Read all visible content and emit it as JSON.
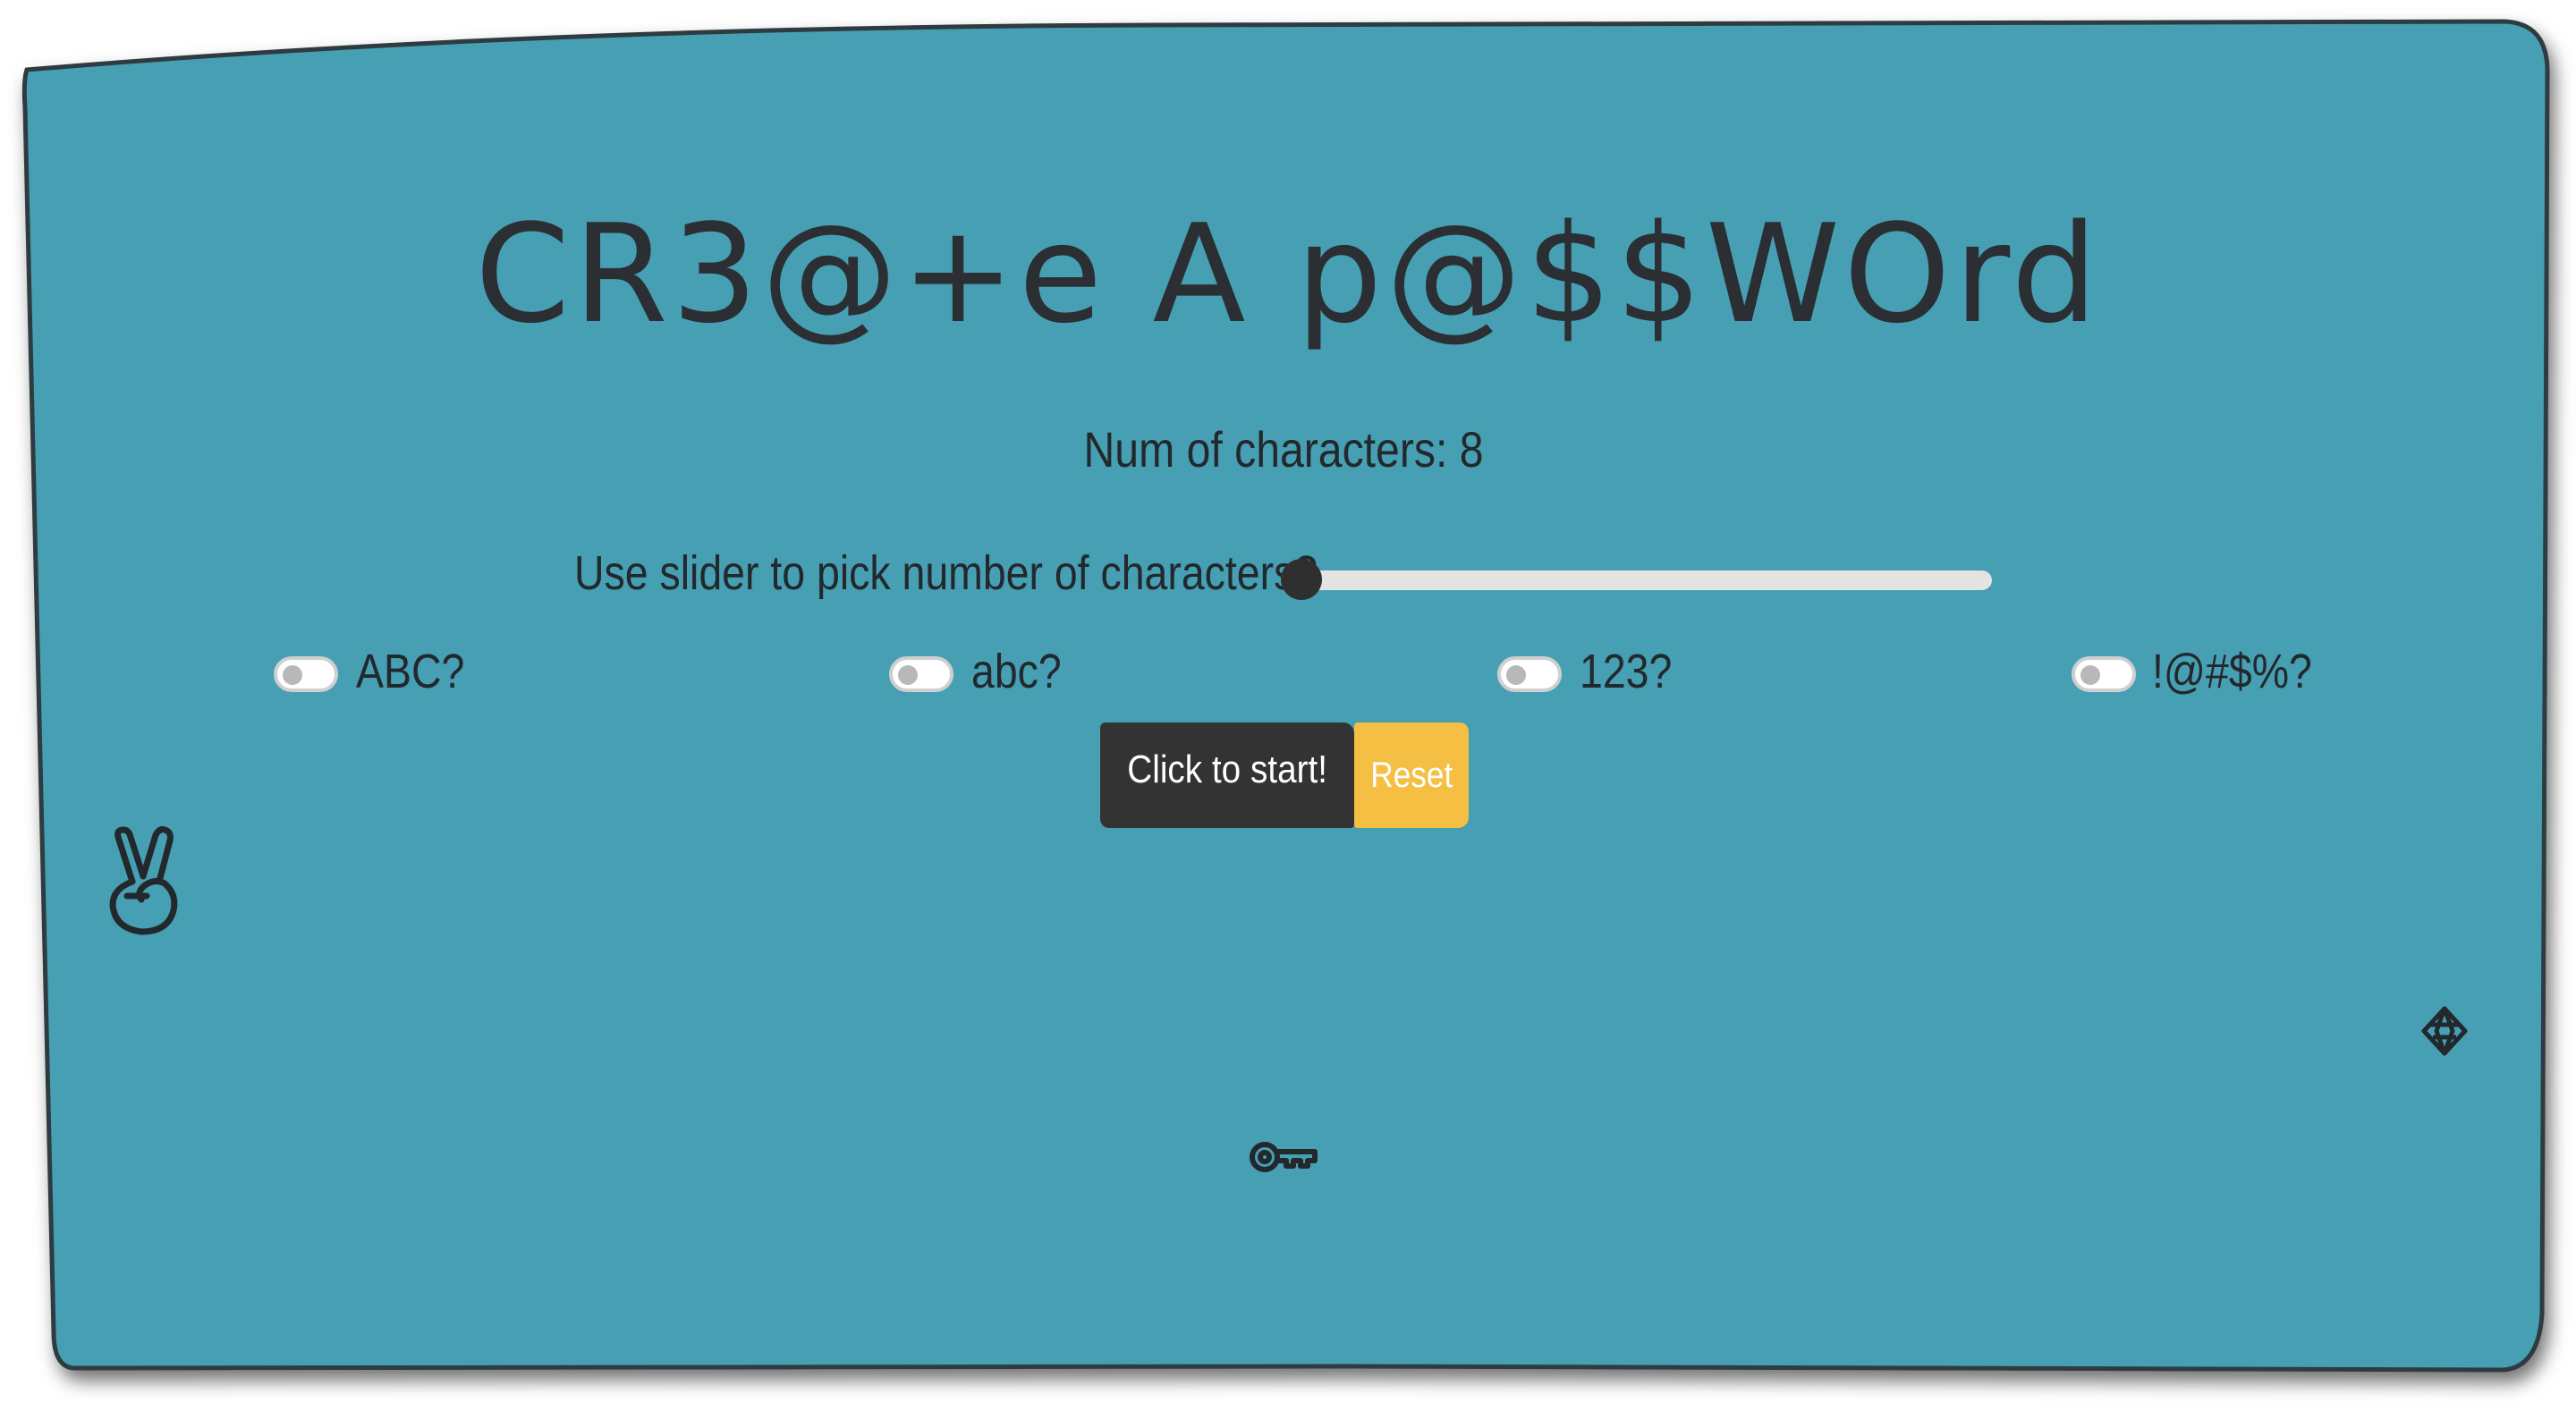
{
  "app": {
    "title": "CR3@+e A p@$$WOrd"
  },
  "header": {
    "num_chars_label": "Num of characters: 8"
  },
  "slider": {
    "label": "Use slider to pick number of characters?",
    "value_fraction": 0.0
  },
  "options": [
    {
      "label": "ABC?",
      "checked": false
    },
    {
      "label": "abc?",
      "checked": false
    },
    {
      "label": "123?",
      "checked": false
    },
    {
      "label": "!@#$%?",
      "checked": false
    }
  ],
  "buttons": {
    "start_label": "Click to start!",
    "reset_label": "Reset"
  },
  "icons": {
    "left": "peace-hand-icon",
    "right": "diamond-icon",
    "bottom": "key-icon"
  },
  "colors": {
    "card_bg": "#479fb4",
    "text": "#22282c",
    "start_button": "#333333",
    "reset_button": "#f4bf42",
    "slider_track": "#e3e3e3"
  }
}
